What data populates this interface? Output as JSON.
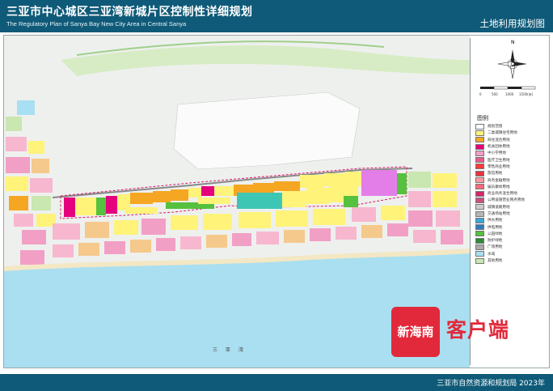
{
  "header": {
    "title": "三亚市中心城区三亚湾新城片区控制性详细规划",
    "subtitle": "The Regulatory Plan of Sanya Bay New City Area in Central Sanya",
    "right_title": "土地利用规划图"
  },
  "map": {
    "water_label": "三 亚 湾",
    "scale_labels": [
      "0",
      "500",
      "1000",
      "1500(米)"
    ],
    "compass": "N"
  },
  "legend": {
    "title": "图例",
    "items": [
      {
        "label": "规划范围",
        "color": "#ffffff"
      },
      {
        "label": "二类城镇住宅用地",
        "color": "#fff37a"
      },
      {
        "label": "商住混合用地",
        "color": "#f5a623"
      },
      {
        "label": "机关团体用地",
        "color": "#e5007e"
      },
      {
        "label": "中小学用地",
        "color": "#f29fc5"
      },
      {
        "label": "医疗卫生用地",
        "color": "#ea5a8b"
      },
      {
        "label": "零售商业用地",
        "color": "#ff3b3b"
      },
      {
        "label": "旅馆用地",
        "color": "#e7343f"
      },
      {
        "label": "商务金融用地",
        "color": "#ff9aa0"
      },
      {
        "label": "娱乐康体用地",
        "color": "#ff6a7d"
      },
      {
        "label": "商业商务混合用地",
        "color": "#d1296b"
      },
      {
        "label": "公用设施营业网点用地",
        "color": "#c6537f"
      },
      {
        "label": "城镇道路用地",
        "color": "#cccccc"
      },
      {
        "label": "交通场站用地",
        "color": "#b5b5b5"
      },
      {
        "label": "供水用地",
        "color": "#3aa6d9"
      },
      {
        "label": "供电用地",
        "color": "#2d7bbf"
      },
      {
        "label": "公园绿地",
        "color": "#55c13e"
      },
      {
        "label": "防护绿地",
        "color": "#2f8a3a"
      },
      {
        "label": "广场用地",
        "color": "#a9a9a9"
      },
      {
        "label": "水域",
        "color": "#a8dff2"
      },
      {
        "label": "其他用地",
        "color": "#c9e7b0"
      }
    ]
  },
  "watermark": {
    "logo_text": "新海南",
    "text": "客户端"
  },
  "footer": {
    "text": "三亚市自然资源和规划局  2023年"
  }
}
